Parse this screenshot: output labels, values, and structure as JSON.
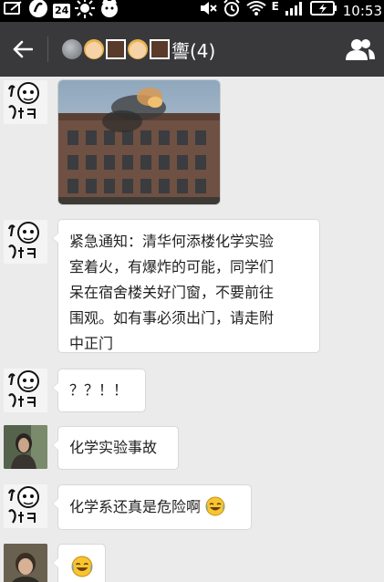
{
  "status_bar": {
    "time": "10:53",
    "notification_24": "24",
    "network_label": "E"
  },
  "header": {
    "title_suffix": "讏(4)",
    "back_icon": "arrow-left-icon",
    "members_icon": "group-members-icon"
  },
  "messages": [
    {
      "sender": "sketch",
      "type": "image",
      "image": "building-on-fire-photo"
    },
    {
      "sender": "sketch",
      "type": "text",
      "lines": [
        "紧急通知：清华何添楼化学实验",
        "室着火，有爆炸的可能，同学们",
        "呆在宿舍楼关好门窗，不要前往",
        "围观。如有事必须出门，请走附",
        "中正门"
      ]
    },
    {
      "sender": "sketch",
      "type": "text",
      "text": "？？！！"
    },
    {
      "sender": "photo",
      "type": "text",
      "text": "化学实验事故"
    },
    {
      "sender": "sketch",
      "type": "text",
      "text": "化学系还真是危险啊",
      "emoji": "crying-laughing-emoji"
    },
    {
      "sender": "photo2",
      "type": "emoji",
      "emoji": "crying-laughing-emoji"
    }
  ],
  "colors": {
    "titlebar": "#39393c",
    "chat_bg": "#ebebeb",
    "bubble": "#ffffff"
  }
}
